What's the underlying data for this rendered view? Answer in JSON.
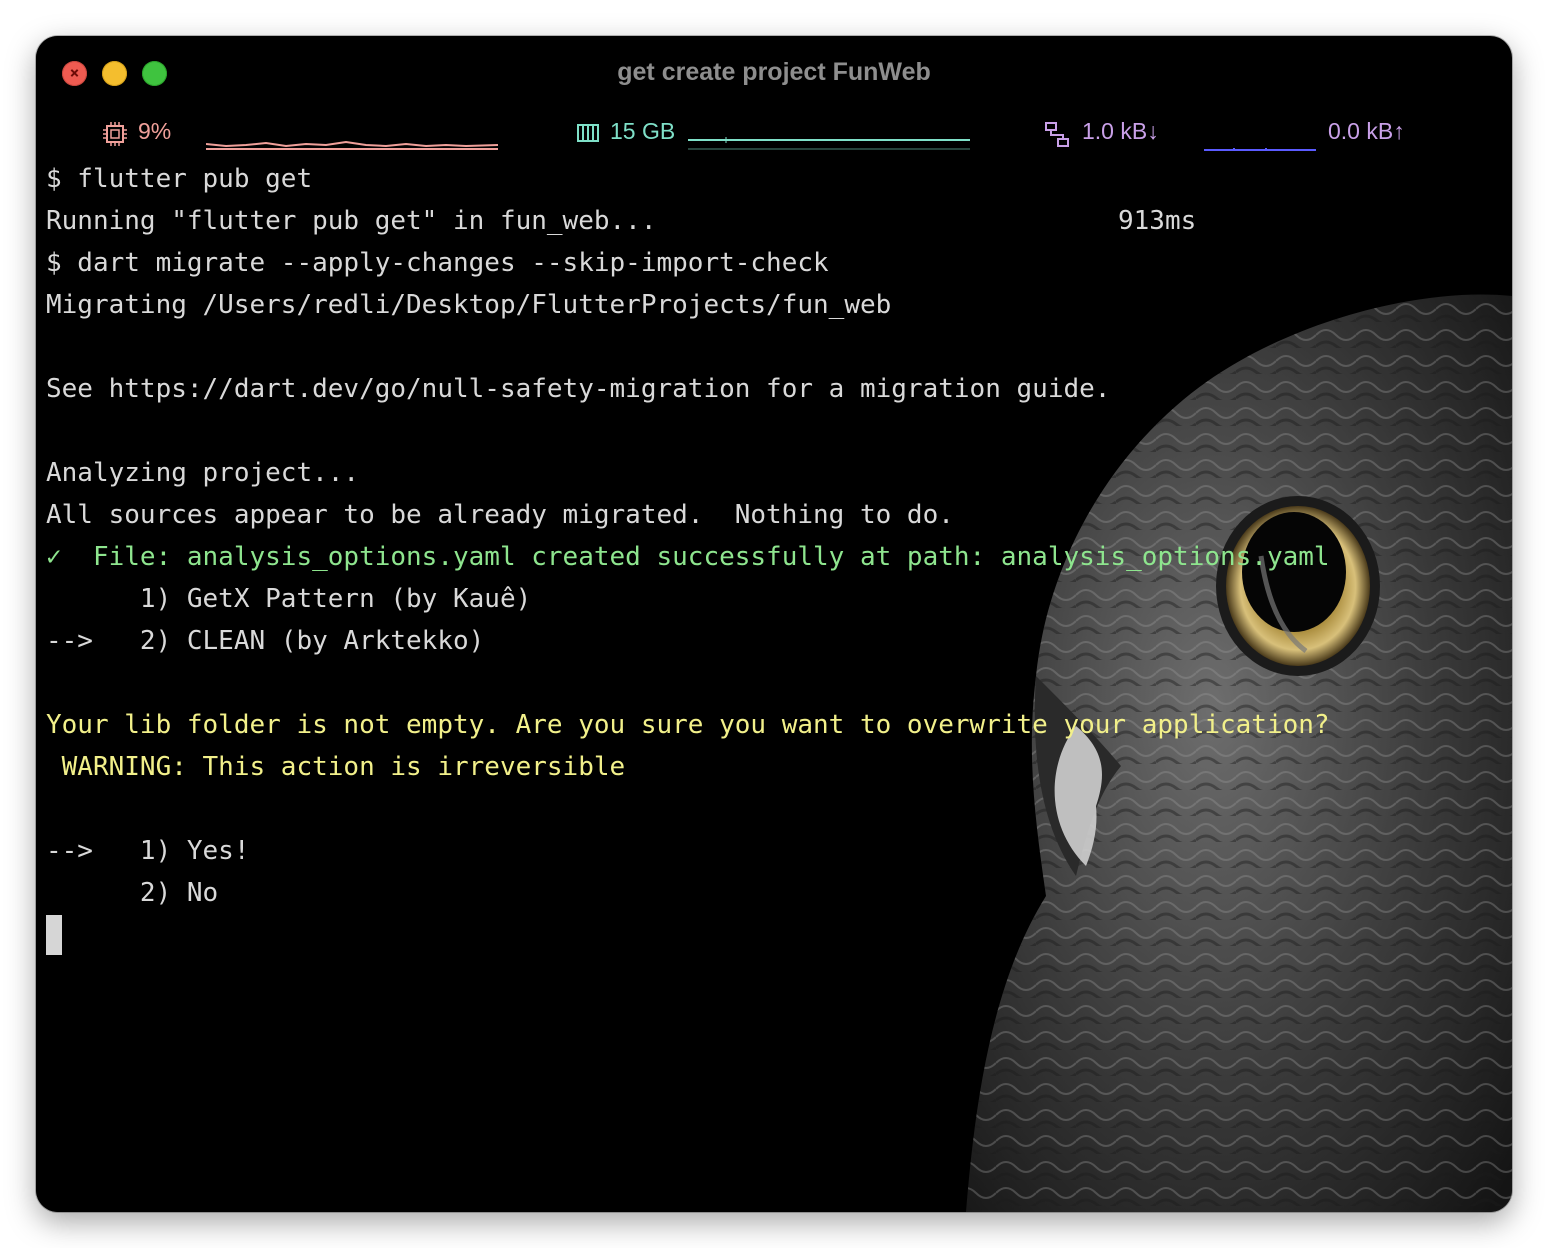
{
  "window": {
    "title": "get create project FunWeb",
    "accent_colors": {
      "close": "#ee5b51",
      "minimize": "#f4be2e",
      "zoom": "#3fc33f"
    }
  },
  "status_bar": {
    "cpu": {
      "icon": "cpu-icon",
      "value": "9%",
      "color": "#f0a09a"
    },
    "memory": {
      "icon": "memory-icon",
      "value": "15 GB",
      "color": "#7fe0c8"
    },
    "network": {
      "icon": "network-icon",
      "down": "1.0 kB↓",
      "up": "0.0 kB↑",
      "down_color": "#c9a0e8",
      "up_color": "#c9a0e8",
      "graph_color": "#5b5bff"
    }
  },
  "terminal": {
    "lines": [
      {
        "text": "$ flutter pub get",
        "style": "normal"
      },
      {
        "text": "Running \"flutter pub get\" in fun_web...",
        "style": "normal",
        "right": "913ms"
      },
      {
        "text": "$ dart migrate --apply-changes --skip-import-check",
        "style": "normal"
      },
      {
        "text": "Migrating /Users/redli/Desktop/FlutterProjects/fun_web",
        "style": "normal"
      },
      {
        "text": "",
        "style": "normal"
      },
      {
        "text": "See https://dart.dev/go/null-safety-migration for a migration guide.",
        "style": "normal"
      },
      {
        "text": "",
        "style": "normal"
      },
      {
        "text": "Analyzing project...",
        "style": "normal"
      },
      {
        "text": "All sources appear to be already migrated.  Nothing to do.",
        "style": "normal"
      },
      {
        "text": "✓  File: analysis_options.yaml created successfully at path: analysis_options.yaml",
        "style": "green"
      },
      {
        "text": "      1) GetX Pattern (by Kauê)",
        "style": "normal"
      },
      {
        "text": "-->   2) CLEAN (by Arktekko)",
        "style": "normal"
      },
      {
        "text": "",
        "style": "normal"
      },
      {
        "text": "Your lib folder is not empty. Are you sure you want to overwrite your application?",
        "style": "yellow"
      },
      {
        "text": " WARNING: This action is irreversible",
        "style": "yellow"
      },
      {
        "text": "",
        "style": "normal"
      },
      {
        "text": "-->   1) Yes!",
        "style": "normal"
      },
      {
        "text": "      2) No",
        "style": "normal"
      }
    ]
  }
}
